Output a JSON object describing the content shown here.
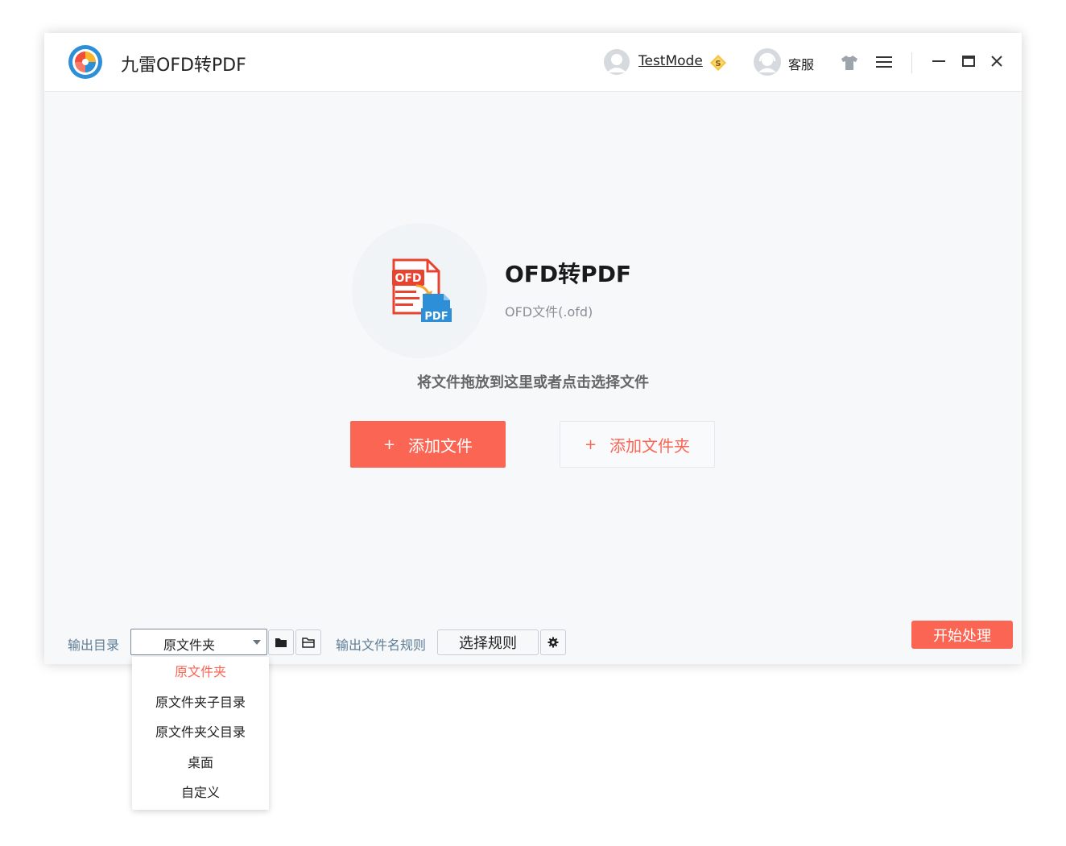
{
  "app": {
    "title": "九雷OFD转PDF"
  },
  "header": {
    "user_name": "TestMode",
    "service_label": "客服"
  },
  "hero": {
    "title": "OFD转PDF",
    "subtitle": "OFD文件(.ofd)",
    "hint": "将文件拖放到这里或者点击选择文件",
    "icon_top_text": "OFD",
    "icon_bottom_text": "PDF"
  },
  "actions": {
    "add_file": "添加文件",
    "add_folder": "添加文件夹",
    "plus": "+"
  },
  "footer": {
    "output_label": "输出目录",
    "output_selected": "原文件夹",
    "rule_label": "输出文件名规则",
    "rule_button": "选择规则",
    "start_button": "开始处理"
  },
  "dropdown": {
    "options": [
      "原文件夹",
      "原文件夹子目录",
      "原文件夹父目录",
      "桌面",
      "自定义"
    ],
    "selected_index": 0
  },
  "colors": {
    "accent": "#fb6553",
    "label": "#5e7d96",
    "background": "#f6f8fa"
  }
}
